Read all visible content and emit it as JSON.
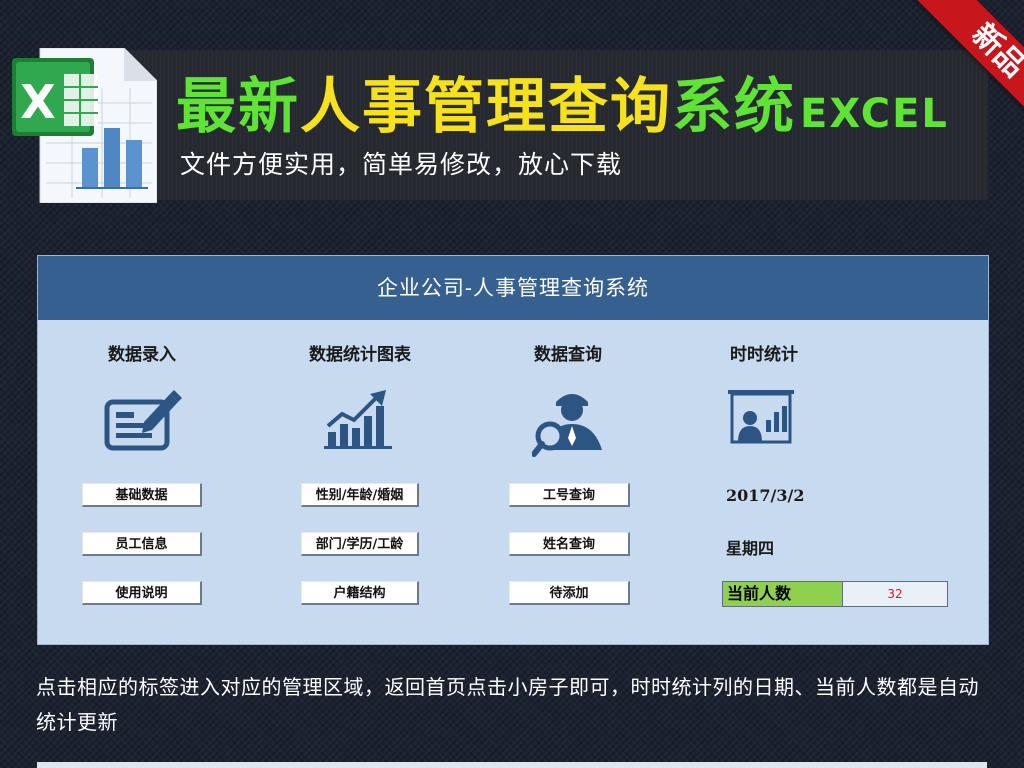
{
  "header": {
    "title_parts": [
      {
        "text": "最新",
        "color": "#5fe334"
      },
      {
        "text": "人事管理查询",
        "color": "#f6e21c"
      },
      {
        "text": "系统",
        "color": "#5fe334"
      }
    ],
    "title_suffix": "EXCEL",
    "subtitle": "文件方便实用，简单易修改，放心下载",
    "ribbon_label": "新品",
    "icons": {
      "logo": "excel-file-icon"
    }
  },
  "panel": {
    "title": "企业公司-人事管理查询系统",
    "columns": [
      {
        "title": "数据录入",
        "icon": "data-entry-icon",
        "buttons": [
          "基础数据",
          "员工信息",
          "使用说明"
        ]
      },
      {
        "title": "数据统计图表",
        "icon": "statistics-chart-icon",
        "buttons": [
          "性别/年龄/婚姻",
          "部门/学历/工龄",
          "户籍结构"
        ]
      },
      {
        "title": "数据查询",
        "icon": "person-search-icon",
        "buttons": [
          "工号查询",
          "姓名查询",
          "待添加"
        ]
      },
      {
        "title": "时时统计",
        "icon": "presentation-board-icon"
      }
    ],
    "realtime": {
      "date": "2017/3/2",
      "weekday": "星期四",
      "count_label": "当前人数",
      "count_value": "32"
    }
  },
  "description": "点击相应的标签进入对应的管理区域，返回首页点击小房子即可，时时统计列的日期、当前人数都是自动统计更新",
  "colors": {
    "panel_header": "#36608f",
    "panel_bg": "#c8daf0",
    "count_label_bg": "#8fd14f",
    "count_value": "#e0142a",
    "ribbon": "#c8161d",
    "icon_blue": "#2d5583"
  }
}
